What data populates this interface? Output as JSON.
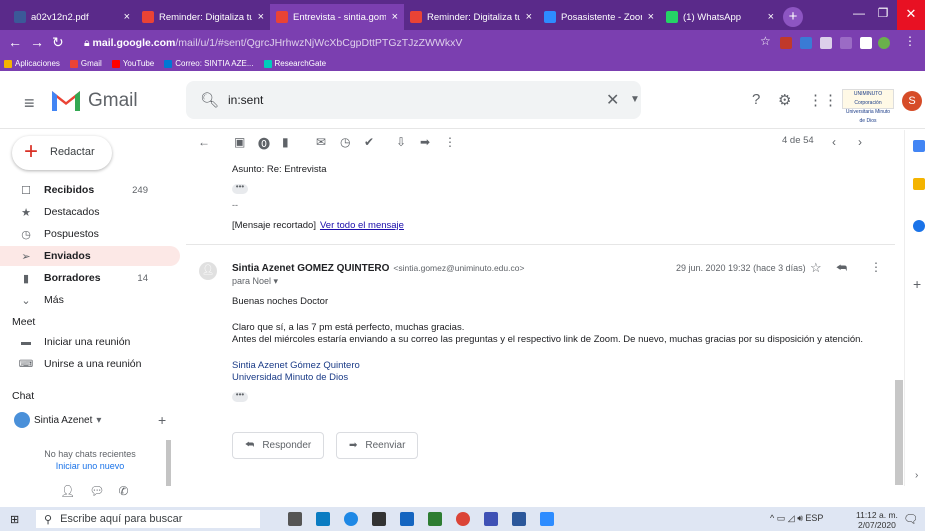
{
  "browser": {
    "tabs": [
      {
        "label": "a02v12n2.pdf",
        "color": "#3b5998"
      },
      {
        "label": "Reminder: Digitaliza tu:",
        "color": "#ea4335"
      },
      {
        "label": "Entrevista - sintia.gome",
        "color": "#ea4335"
      },
      {
        "label": "Reminder: Digitaliza tu",
        "color": "#ea4335"
      },
      {
        "label": "Posasistente - Zoom",
        "color": "#2d8cff"
      },
      {
        "label": "(1) WhatsApp",
        "color": "#25d366"
      }
    ],
    "tab_close": "×",
    "new_tab": "+",
    "address_host": "mail.google.com",
    "address_path": "/mail/u/1/#sent/QgrcJHrhwzNjWcXbCgpDttPTGzTJzZWWkxV",
    "bookmarks": [
      "Aplicaciones",
      "Gmail",
      "YouTube",
      "Correo: SINTIA AZE...",
      "ResearchGate"
    ]
  },
  "gmail": {
    "logo_text": "Gmail",
    "search_value": "in:sent",
    "uni_logo": "UNIMINUTO Corporación Universitaria Minuto de Dios",
    "avatar_letter": "S"
  },
  "sidebar": {
    "compose_label": "Redactar",
    "items": [
      {
        "icon": "inbox-icon",
        "glyph": "☐",
        "label": "Recibidos",
        "count": "249",
        "bold": true
      },
      {
        "icon": "star-icon",
        "glyph": "★",
        "label": "Destacados",
        "count": ""
      },
      {
        "icon": "clock-icon",
        "glyph": "◷",
        "label": "Pospuestos",
        "count": ""
      },
      {
        "icon": "send-icon",
        "glyph": "➢",
        "label": "Enviados",
        "count": "",
        "bold": true,
        "selected": true
      },
      {
        "icon": "draft-icon",
        "glyph": "▮",
        "label": "Borradores",
        "count": "14",
        "bold": true
      },
      {
        "icon": "chevron-down-icon",
        "glyph": "⌄",
        "label": "Más",
        "count": ""
      }
    ],
    "meet_title": "Meet",
    "meet_items": [
      "Iniciar una reunión",
      "Unirse a una reunión"
    ],
    "chat_title": "Chat",
    "chat_user": "Sintia Azenet",
    "no_chats": "No hay chats recientes",
    "start_new": "Iniciar uno nuevo"
  },
  "toolbar": {
    "pager": "4 de 54"
  },
  "email": {
    "subject_line": "Asunto: Re: Entrevista",
    "dots": "•••",
    "dash": "--",
    "clipped": "[Mensaje recortado]",
    "view_all": "Ver todo el mensaje",
    "sender_name": "Sintia Azenet GOMEZ QUINTERO",
    "sender_email": "<sintia.gomez@uniminuto.edu.co>",
    "to": "para Noel",
    "date": "29 jun. 2020 19:32 (hace 3 días)",
    "greeting": "Buenas noches Doctor",
    "line1": "Claro que sí, a las 7 pm está perfecto, muchas gracias.",
    "line2": "Antes del miércoles estaría enviando a su correo las preguntas y el respectivo link de Zoom. De nuevo, muchas gracias por su disposición y atención.",
    "sig_name": "Sintia Azenet Gómez Quintero",
    "sig_org": "Universidad Minuto de Dios",
    "reply_label": "Responder",
    "forward_label": "Reenviar"
  },
  "taskbar": {
    "search_placeholder": "Escribe aquí para buscar",
    "lang": "ESP",
    "time": "11:12 a. m.",
    "date": "2/07/2020"
  }
}
